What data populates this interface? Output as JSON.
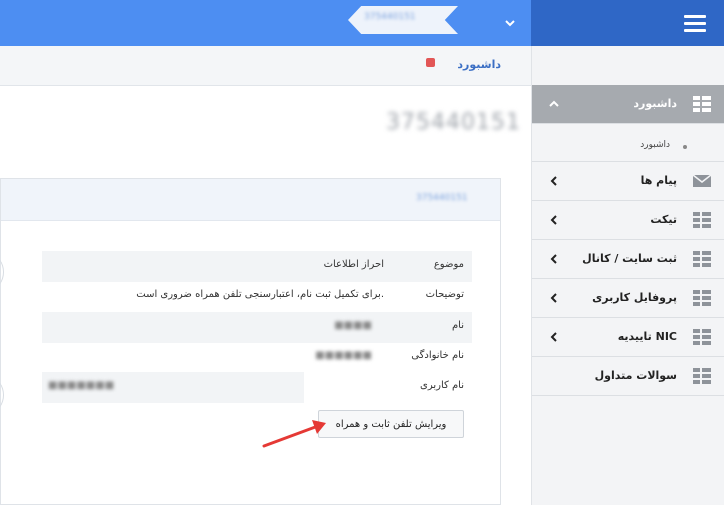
{
  "topbar": {
    "menu_icon": "hamburger-icon",
    "dropdown_icon": "chevron-down-icon"
  },
  "breadcrumb": {
    "home": "داشبورد",
    "current_id": "375440151"
  },
  "page": {
    "title": "375440151"
  },
  "panel": {
    "header_id": "375440151",
    "rows": [
      {
        "label": "موضوع",
        "value": "احراز اطلاعات"
      },
      {
        "label": "توضیحات",
        "value": "برای تکمیل ثبت نام، اعتبارسنجی تلفن همراه ضروری است."
      },
      {
        "label": "نام",
        "value": "■■■■"
      },
      {
        "label": "نام خانوادگی",
        "value": "■■■■■■"
      },
      {
        "label": "نام کاربری",
        "value": "■■■■■■■"
      }
    ],
    "edit_button": "ویرایش تلفن ثابت و همراه"
  },
  "sidebar": {
    "items": [
      {
        "label": "داشبورد",
        "icon": "grid-icon",
        "chevron": "chevron-up-icon"
      },
      {
        "label": "پیام ها",
        "icon": "envelope-icon",
        "chevron": "chevron-left-icon"
      },
      {
        "label": "تیکت",
        "icon": "grid-icon",
        "chevron": "chevron-left-icon"
      },
      {
        "label": "ثبت سایت / کانال",
        "icon": "grid-icon",
        "chevron": "chevron-left-icon"
      },
      {
        "label": "پروفایل کاربری",
        "icon": "grid-icon",
        "chevron": "chevron-left-icon"
      },
      {
        "label": "تاییدیه NIC",
        "icon": "grid-icon",
        "chevron": "chevron-left-icon"
      },
      {
        "label": "سوالات متداول",
        "icon": "grid-icon",
        "chevron": ""
      }
    ],
    "sub_item": "داشبورد"
  },
  "colors": {
    "topbar": "#4d8ef2",
    "topbar_dark": "#2f67c6",
    "active_item": "#a6aaaf",
    "arrow": "#e53935"
  }
}
